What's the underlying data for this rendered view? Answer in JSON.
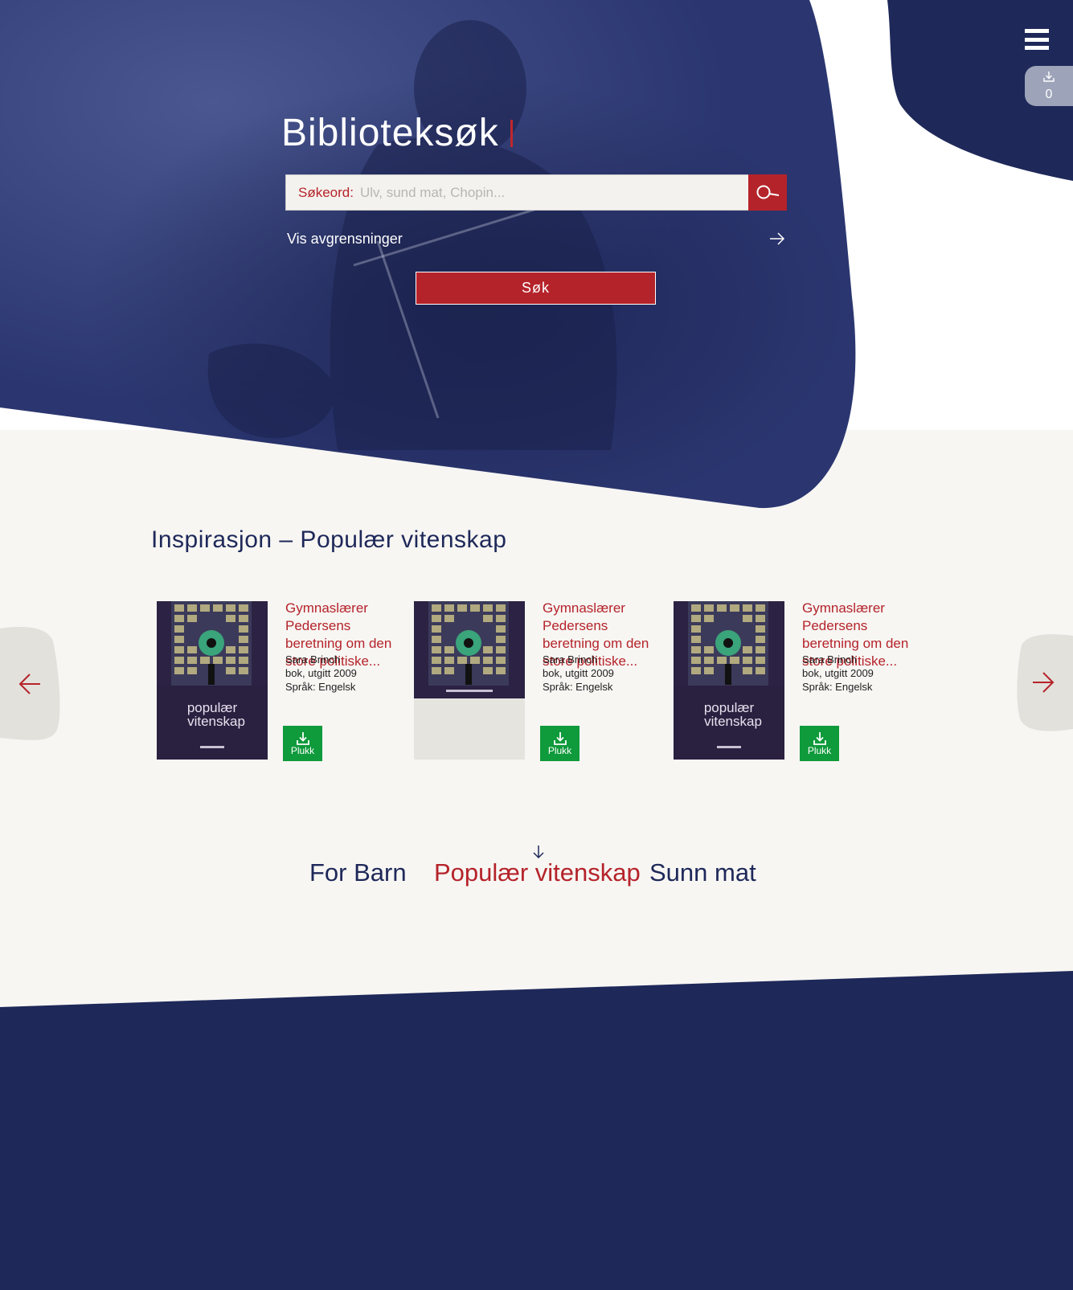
{
  "hero": {
    "title": "Biblioteksøk",
    "search_label": "Søkeord:",
    "search_placeholder": "Ulv, sund mat, Chopin...",
    "search_value": "",
    "filter_label": "Vis avgrensninger",
    "submit_label": "Søk"
  },
  "header": {
    "menu_icon": "hamburger-icon",
    "cart_icon": "download-icon",
    "cart_count": "0"
  },
  "inspiration": {
    "heading": "Inspirasjon – Populær vitenskap",
    "prev_icon": "arrow-left-icon",
    "next_icon": "arrow-right-icon",
    "cards": [
      {
        "title": "Gymnaslærer Pedersens beretning om den store politiske...",
        "author": "Sara Brinch",
        "type": "bok, utgitt 2009",
        "language": "Språk: Engelsk",
        "cover_title_1": "populær",
        "cover_title_2": "vitenskap",
        "action_label": "Plukk",
        "cover_complete": true
      },
      {
        "title": "Gymnaslærer Pedersens beretning om den store politiske...",
        "author": "Sara Brinch",
        "type": "bok, utgitt 2009",
        "language": "Språk: Engelsk",
        "action_label": "Plukk",
        "cover_complete": false
      },
      {
        "title": "Gymnaslærer Pedersens beretning om den store politiske...",
        "author": "Sara Brinch",
        "type": "bok, utgitt 2009",
        "language": "Språk: Engelsk",
        "cover_title_1": "populær",
        "cover_title_2": "vitenskap",
        "action_label": "Plukk",
        "cover_complete": true
      }
    ]
  },
  "categories": {
    "items": [
      "For Barn",
      "Populær vitenskap",
      "Sunn mat"
    ],
    "active": "Populær vitenskap"
  },
  "colors": {
    "navy": "#1e2859",
    "accent_red": "#b5232a",
    "green": "#0f9a3b",
    "background": "#f7f6f3"
  }
}
